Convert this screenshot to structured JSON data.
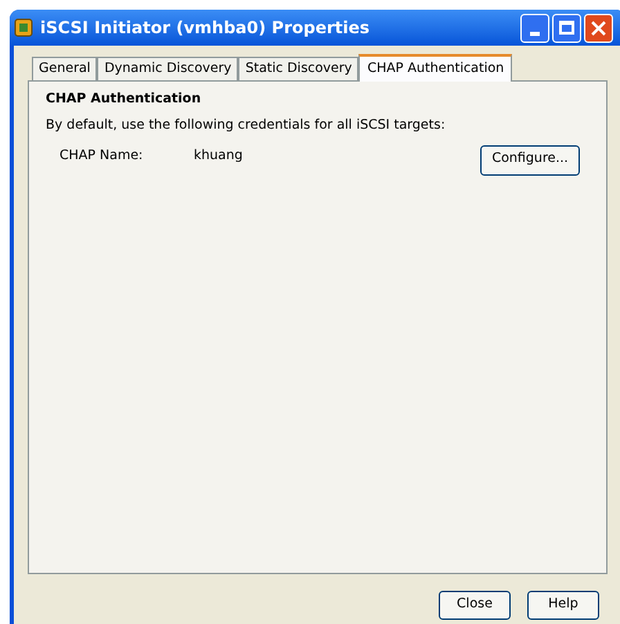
{
  "window": {
    "title": "iSCSI Initiator (vmhba0) Properties"
  },
  "tabs": [
    {
      "label": "General",
      "selected": false
    },
    {
      "label": "Dynamic Discovery",
      "selected": false
    },
    {
      "label": "Static Discovery",
      "selected": false
    },
    {
      "label": "CHAP Authentication",
      "selected": true
    }
  ],
  "section": {
    "heading": "CHAP Authentication",
    "description": "By default, use the following credentials for all iSCSI targets:",
    "field_label": "CHAP Name:",
    "field_value": "khuang",
    "button": "Configure..."
  },
  "buttons": [
    "Close",
    "Help"
  ]
}
